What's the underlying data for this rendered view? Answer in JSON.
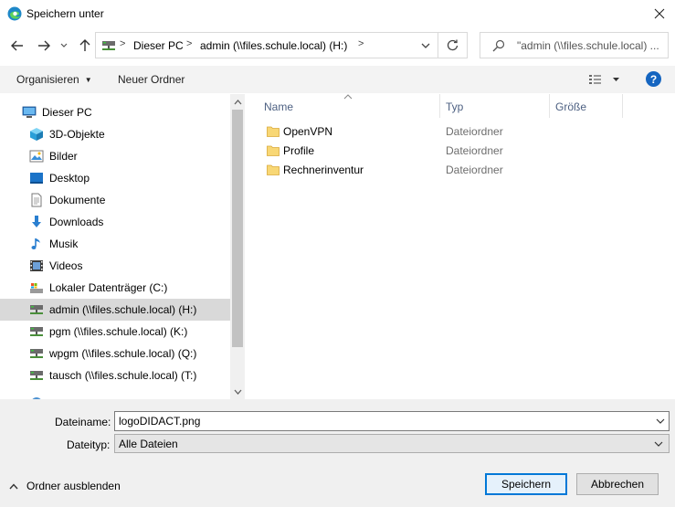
{
  "window": {
    "title": "Speichern unter"
  },
  "address": {
    "crumbs": [
      "Dieser PC",
      "admin (\\\\files.schule.local) (H:)"
    ]
  },
  "search": {
    "text": "\"admin (\\\\files.schule.local) ..."
  },
  "toolbar": {
    "organize_label": "Organisieren",
    "new_folder_label": "Neuer Ordner",
    "help_label": "?"
  },
  "nav": {
    "items": [
      {
        "label": "Dieser PC",
        "icon": "pc-icon"
      },
      {
        "label": "3D-Objekte",
        "icon": "cube-icon"
      },
      {
        "label": "Bilder",
        "icon": "pictures-icon"
      },
      {
        "label": "Desktop",
        "icon": "desktop-icon"
      },
      {
        "label": "Dokumente",
        "icon": "documents-icon"
      },
      {
        "label": "Downloads",
        "icon": "download-icon"
      },
      {
        "label": "Musik",
        "icon": "music-icon"
      },
      {
        "label": "Videos",
        "icon": "videos-icon"
      },
      {
        "label": "Lokaler Datenträger (C:)",
        "icon": "local-drive-icon"
      },
      {
        "label": "admin (\\\\files.schule.local) (H:)",
        "icon": "network-drive-icon",
        "selected": true
      },
      {
        "label": "pgm (\\\\files.schule.local) (K:)",
        "icon": "network-drive-icon"
      },
      {
        "label": "wpgm (\\\\files.schule.local) (Q:)",
        "icon": "network-drive-icon"
      },
      {
        "label": "tausch (\\\\files.schule.local) (T:)",
        "icon": "network-drive-icon"
      }
    ]
  },
  "files": {
    "columns": [
      "Name",
      "Typ",
      "Größe"
    ],
    "rows": [
      {
        "name": "OpenVPN",
        "type": "Dateiordner"
      },
      {
        "name": "Profile",
        "type": "Dateiordner"
      },
      {
        "name": "Rechnerinventur",
        "type": "Dateiordner"
      }
    ]
  },
  "form": {
    "filename_label": "Dateiname:",
    "filename_value": "logoDIDACT.png",
    "filetype_label": "Dateityp:",
    "filetype_value": "Alle Dateien"
  },
  "footer": {
    "hide_folders_label": "Ordner ausblenden",
    "save_label": "Speichern",
    "cancel_label": "Abbrechen"
  },
  "colors": {
    "accent": "#0078d7",
    "selected_nav": "#d9d9d9",
    "toolbar_bg": "#f3f3f3",
    "folder": "#f8d775"
  }
}
